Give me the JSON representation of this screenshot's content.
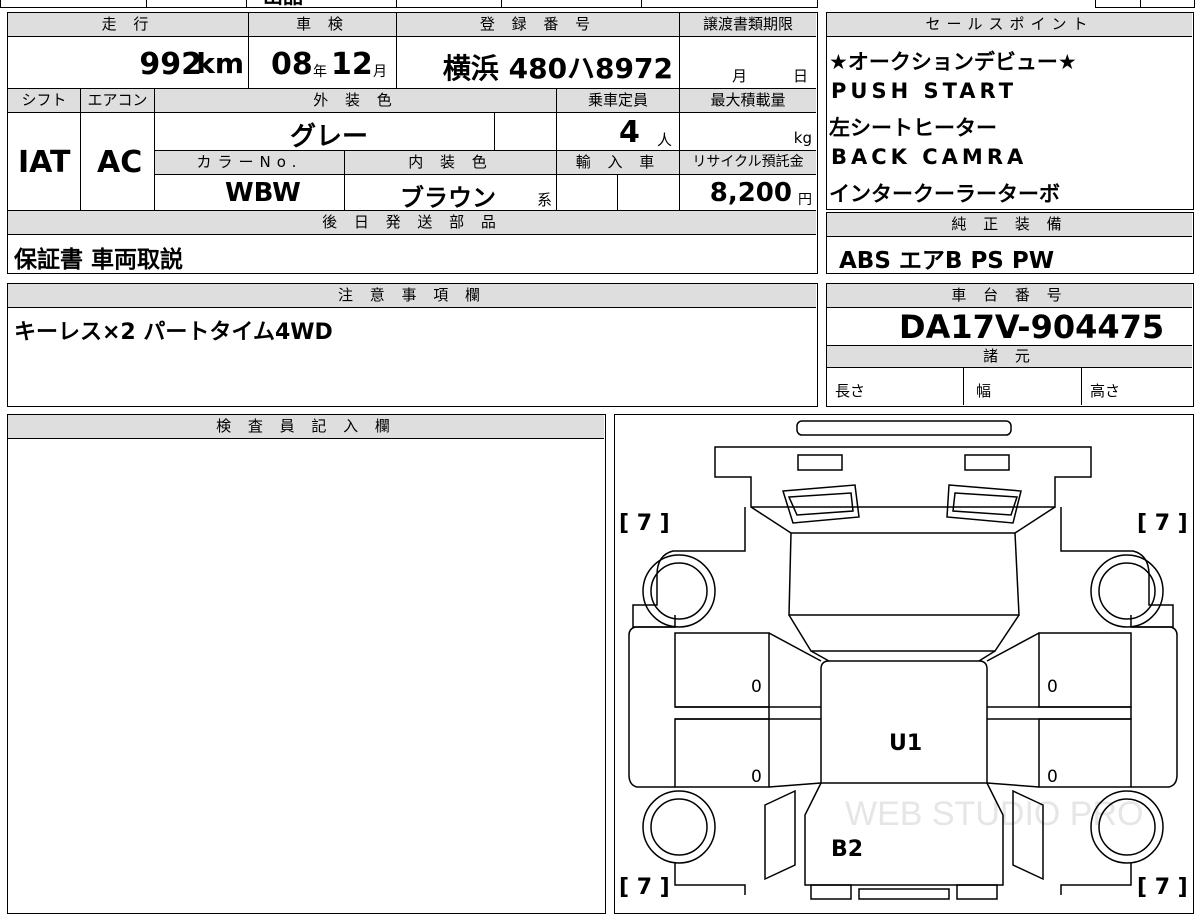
{
  "top_strip": {
    "cut_title": "出品"
  },
  "main_table": {
    "mileage": {
      "header": "走 行",
      "value": "992",
      "unit": "km"
    },
    "inspection": {
      "header": "車 検",
      "year": "08",
      "year_unit": "年",
      "month": "12",
      "month_unit": "月"
    },
    "registration": {
      "header": "登 録 番 号",
      "value": "横浜 480ハ8972"
    },
    "transfer_deadline": {
      "header": "譲渡書類期限",
      "month_unit": "月",
      "day_unit": "日"
    },
    "shift": {
      "header": "シフト",
      "value": "IAT"
    },
    "aircon": {
      "header": "エアコン",
      "value": "AC"
    },
    "exterior_color": {
      "header": "外 装 色",
      "value": "グレー"
    },
    "capacity": {
      "header": "乗車定員",
      "value": "4",
      "unit": "人"
    },
    "max_load": {
      "header": "最大積載量",
      "unit": "kg"
    },
    "color_no": {
      "header": "カラーNo.",
      "value": "WBW"
    },
    "interior_color": {
      "header": "内 装 色",
      "value": "ブラウン",
      "suffix": "系"
    },
    "import_car": {
      "header": "輸 入 車"
    },
    "recycle_fee": {
      "header": "リサイクル預託金",
      "value": "8,200",
      "unit": "円"
    },
    "later_shipping": {
      "header": "後 日 発 送 部 品",
      "value": "保証書 車両取説"
    }
  },
  "sales_points": {
    "header": "セールスポイント",
    "lines": [
      "★オークションデビュー★",
      "PUSH START",
      "左シートヒーター",
      "BACK CAMRA",
      "インタークーラーターボ"
    ]
  },
  "genuine_equipment": {
    "header": "純 正 装 備",
    "value": "ABS エアB PS PW"
  },
  "notes": {
    "header": "注 意 事 項 欄",
    "value": "キーレス×2 パートタイム4WD"
  },
  "chassis": {
    "header": "車 台 番 号",
    "value": "DA17V-904475"
  },
  "specs": {
    "header": "諸 元",
    "length": "長さ",
    "width": "幅",
    "height": "高さ"
  },
  "inspector": {
    "header": "検 査 員 記 入 欄"
  },
  "diagram": {
    "tire_front_left": "[ 7 ]",
    "tire_front_right": "[ 7 ]",
    "tire_rear_left": "[ 7 ]",
    "tire_rear_right": "[ 7 ]",
    "door_mark_1": "0",
    "door_mark_2": "0",
    "door_mark_3": "0",
    "door_mark_4": "0",
    "roof_mark": "U1",
    "rear_mark": "B2",
    "watermark": "WEB STUDIO PRO"
  }
}
